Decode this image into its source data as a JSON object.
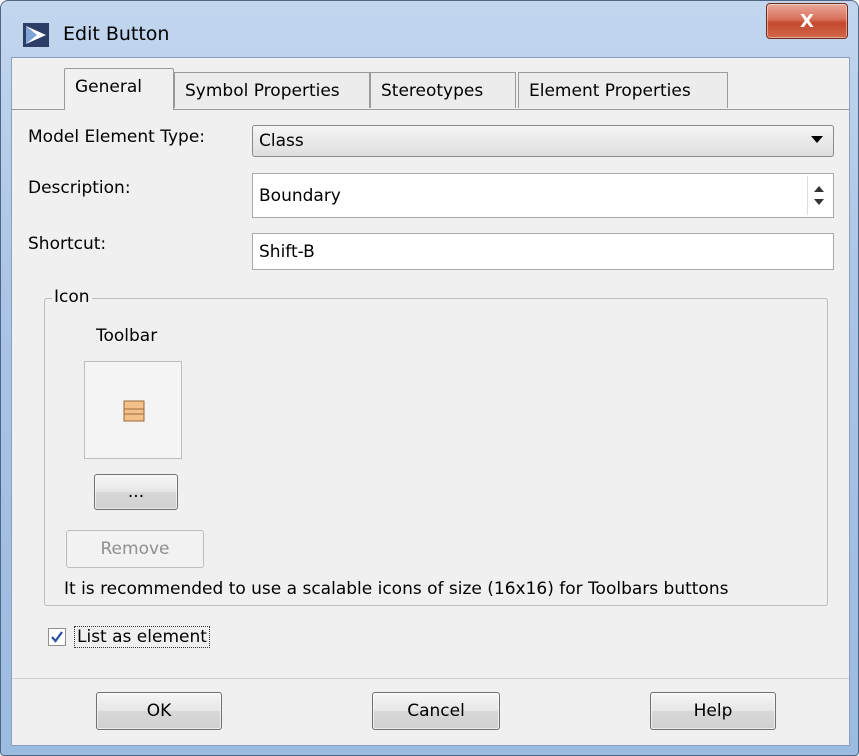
{
  "window": {
    "title": "Edit Button",
    "close_label": "X"
  },
  "tabs": [
    {
      "label": "General",
      "active": true
    },
    {
      "label": "Symbol Properties"
    },
    {
      "label": "Stereotypes"
    },
    {
      "label": "Element Properties"
    }
  ],
  "form": {
    "model_element_type_label": "Model Element Type:",
    "model_element_type_value": "Class",
    "description_label": "Description:",
    "description_value": "Boundary",
    "shortcut_label": "Shortcut:",
    "shortcut_value": "Shift-B"
  },
  "icon_group": {
    "legend": "Icon",
    "toolbar_label": "Toolbar",
    "browse_label": "...",
    "remove_label": "Remove",
    "hint": "It is recommended to use a scalable icons of size (16x16) for Toolbars buttons"
  },
  "list_as_element": {
    "label": "List as element",
    "checked": true
  },
  "buttons": {
    "ok": "OK",
    "cancel": "Cancel",
    "help": "Help"
  },
  "colors": {
    "accent": "#9cbbe1",
    "icon_fill": "#f3c08a",
    "icon_stroke": "#9a6a3a",
    "checkmark": "#2a4fa0"
  }
}
